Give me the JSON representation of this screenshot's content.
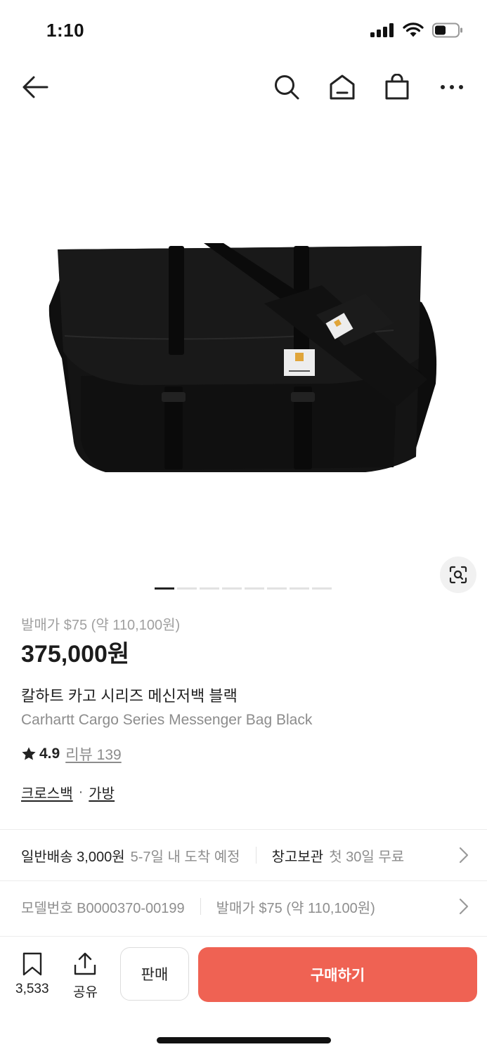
{
  "status": {
    "time": "1:10"
  },
  "nav": {
    "icons": [
      "back-arrow-icon",
      "search-icon",
      "home-icon",
      "shopping-bag-icon",
      "more-icon"
    ]
  },
  "product": {
    "image_alt": "Carhartt Cargo Series Messenger Bag Black",
    "image_count": 8,
    "image_current": 1,
    "release_price": "발매가 $75 (약 110,100원)",
    "price": "375,000원",
    "name_ko": "칼하트 카고 시리즈 메신저백 블랙",
    "name_en": "Carhartt Cargo Series Messenger Bag Black",
    "rating": "4.9",
    "review_label": "리뷰 139",
    "category_1": "크로스백",
    "category_sep": "·",
    "category_2": "가방"
  },
  "shipping_row": {
    "delivery_label": "일반배송 3,000원",
    "delivery_eta": "5-7일 내 도착 예정",
    "storage_label": "창고보관",
    "storage_detail": "첫 30일 무료"
  },
  "detail_row": {
    "model": "모델번호 B0000370-00199",
    "release": "발매가 $75 (약 110,100원)"
  },
  "bottom": {
    "bookmark_count": "3,533",
    "share_label": "공유",
    "sell_label": "판매",
    "buy_label": "구매하기"
  },
  "colors": {
    "accent": "#ef6253",
    "text_primary": "#222222",
    "text_secondary": "#8c8c8c"
  }
}
